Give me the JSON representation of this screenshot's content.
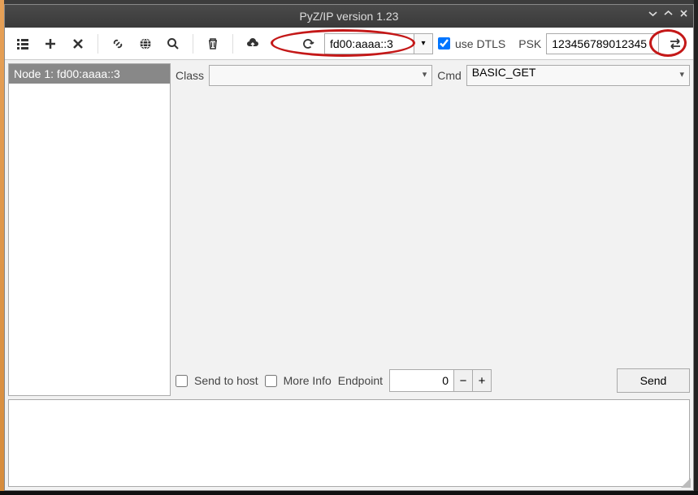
{
  "window": {
    "title": "PyZ/IP version 1.23"
  },
  "toolbar": {
    "address": "fd00:aaaa::3",
    "use_dtls_label": "use DTLS",
    "use_dtls_checked": true,
    "psk_label": "PSK",
    "psk_value": "123456789012345"
  },
  "nodes": [
    {
      "label": "Node 1: fd00:aaaa::3"
    }
  ],
  "cmdrow": {
    "class_label": "Class",
    "class_value": "",
    "cmd_label": "Cmd",
    "cmd_value": "BASIC_GET"
  },
  "options": {
    "send_to_host_label": "Send to host",
    "more_info_label": "More Info",
    "endpoint_label": "Endpoint",
    "endpoint_value": "0",
    "send_label": "Send"
  }
}
